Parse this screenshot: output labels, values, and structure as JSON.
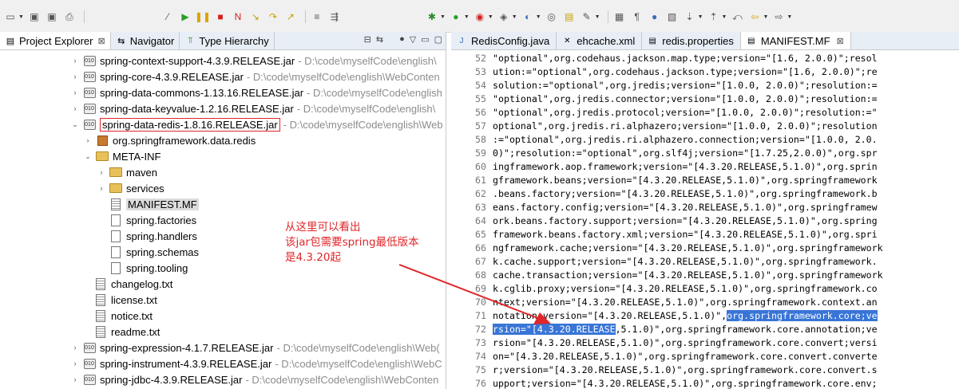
{
  "left_tabs": [
    {
      "label": "Project Explorer",
      "close": "⊠"
    },
    {
      "label": "Navigator",
      "close": ""
    },
    {
      "label": "Type Hierarchy",
      "close": ""
    }
  ],
  "tree": [
    {
      "name": "spring-context-support-4.3.9.RELEASE.jar",
      "path": "- D:\\code\\myselfCode\\english\\"
    },
    {
      "name": "spring-core-4.3.9.RELEASE.jar",
      "path": "- D:\\code\\myselfCode\\english\\WebConten"
    },
    {
      "name": "spring-data-commons-1.13.16.RELEASE.jar",
      "path": "- D:\\code\\myselfCode\\english"
    },
    {
      "name": "spring-data-keyvalue-1.2.16.RELEASE.jar",
      "path": "- D:\\code\\myselfCode\\english\\"
    },
    {
      "name": "spring-data-redis-1.8.16.RELEASE.jar",
      "path": "- D:\\code\\myselfCode\\english\\Web"
    },
    {
      "name": "org.springframework.data.redis",
      "path": ""
    },
    {
      "name": "META-INF",
      "path": ""
    },
    {
      "name": "maven",
      "path": ""
    },
    {
      "name": "services",
      "path": ""
    },
    {
      "name": "MANIFEST.MF",
      "path": ""
    },
    {
      "name": "spring.factories",
      "path": ""
    },
    {
      "name": "spring.handlers",
      "path": ""
    },
    {
      "name": "spring.schemas",
      "path": ""
    },
    {
      "name": "spring.tooling",
      "path": ""
    },
    {
      "name": "changelog.txt",
      "path": ""
    },
    {
      "name": "license.txt",
      "path": ""
    },
    {
      "name": "notice.txt",
      "path": ""
    },
    {
      "name": "readme.txt",
      "path": ""
    },
    {
      "name": "spring-expression-4.1.7.RELEASE.jar",
      "path": "- D:\\code\\myselfCode\\english\\Web("
    },
    {
      "name": "spring-instrument-4.3.9.RELEASE.jar",
      "path": "- D:\\code\\myselfCode\\english\\WebC"
    },
    {
      "name": "spring-jdbc-4.3.9.RELEASE.jar",
      "path": "- D:\\code\\myselfCode\\english\\WebConten"
    }
  ],
  "editor_tabs": [
    {
      "label": "RedisConfig.java",
      "close": ""
    },
    {
      "label": "ehcache.xml",
      "close": ""
    },
    {
      "label": "redis.properties",
      "close": ""
    },
    {
      "label": "MANIFEST.MF",
      "close": "⊠"
    }
  ],
  "code_lines": [
    {
      "n": "52",
      "t": "\"optional\",org.codehaus.jackson.map.type;version=\"[1.6, 2.0.0)\";resol",
      "hl": ""
    },
    {
      "n": "53",
      "t": "ution:=\"optional\",org.codehaus.jackson.type;version=\"[1.6, 2.0.0)\";re",
      "hl": ""
    },
    {
      "n": "54",
      "t": "solution:=\"optional\",org.jredis;version=\"[1.0.0, 2.0.0)\";resolution:=",
      "hl": ""
    },
    {
      "n": "55",
      "t": "\"optional\",org.jredis.connector;version=\"[1.0.0, 2.0.0)\";resolution:=",
      "hl": ""
    },
    {
      "n": "56",
      "t": "\"optional\",org.jredis.protocol;version=\"[1.0.0, 2.0.0)\";resolution:=\"",
      "hl": ""
    },
    {
      "n": "57",
      "t": "optional\",org.jredis.ri.alphazero;version=\"[1.0.0, 2.0.0)\";resolution",
      "hl": ""
    },
    {
      "n": "58",
      "t": ":=\"optional\",org.jredis.ri.alphazero.connection;version=\"[1.0.0, 2.0.",
      "hl": ""
    },
    {
      "n": "59",
      "t": "0)\";resolution:=\"optional\",org.slf4j;version=\"[1.7.25,2.0.0)\",org.spr",
      "hl": ""
    },
    {
      "n": "60",
      "t": "ingframework.aop.framework;version=\"[4.3.20.RELEASE,5.1.0)\",org.sprin",
      "hl": ""
    },
    {
      "n": "61",
      "t": "gframework.beans;version=\"[4.3.20.RELEASE,5.1.0)\",org.springframework",
      "hl": ""
    },
    {
      "n": "62",
      "t": ".beans.factory;version=\"[4.3.20.RELEASE,5.1.0)\",org.springframework.b",
      "hl": ""
    },
    {
      "n": "63",
      "t": "eans.factory.config;version=\"[4.3.20.RELEASE,5.1.0)\",org.springframew",
      "hl": ""
    },
    {
      "n": "64",
      "t": "ork.beans.factory.support;version=\"[4.3.20.RELEASE,5.1.0)\",org.spring",
      "hl": ""
    },
    {
      "n": "65",
      "t": "framework.beans.factory.xml;version=\"[4.3.20.RELEASE,5.1.0)\",org.spri",
      "hl": ""
    },
    {
      "n": "66",
      "t": "ngframework.cache;version=\"[4.3.20.RELEASE,5.1.0)\",org.springframework",
      "hl": ""
    },
    {
      "n": "67",
      "t": "k.cache.support;version=\"[4.3.20.RELEASE,5.1.0)\",org.springframework.",
      "hl": ""
    },
    {
      "n": "68",
      "t": "cache.transaction;version=\"[4.3.20.RELEASE,5.1.0)\",org.springframework",
      "hl": ""
    },
    {
      "n": "69",
      "t": "k.cglib.proxy;version=\"[4.3.20.RELEASE,5.1.0)\",org.springframework.co",
      "hl": ""
    },
    {
      "n": "70",
      "t": "ntext;version=\"[4.3.20.RELEASE,5.1.0)\",org.springframework.context.an",
      "hl": ""
    },
    {
      "n": "71",
      "t": "notation;version=\"[4.3.20.RELEASE,5.1.0)\",",
      "hl": "org.springframework.core;ve"
    },
    {
      "n": "72",
      "t": "",
      "hl": "rsion=\"[4.3.20.RELEASE",
      "tail": ",5.1.0)\",org.springframework.core.annotation;ve"
    },
    {
      "n": "73",
      "t": "rsion=\"[4.3.20.RELEASE,5.1.0)\",org.springframework.core.convert;versi",
      "hl": ""
    },
    {
      "n": "74",
      "t": "on=\"[4.3.20.RELEASE,5.1.0)\",org.springframework.core.convert.converte",
      "hl": ""
    },
    {
      "n": "75",
      "t": "r;version=\"[4.3.20.RELEASE,5.1.0)\",org.springframework.core.convert.s",
      "hl": ""
    },
    {
      "n": "76",
      "t": "upport;version=\"[4.3.20.RELEASE,5.1.0)\",org.springframework.core.env;",
      "hl": ""
    }
  ],
  "annotation": {
    "line1": "从这里可以看出",
    "line2": "该jar包需要spring最低版本",
    "line3": "是4.3.20起",
    "color": "#e0262a"
  },
  "colors": {
    "selection": "#3875d7",
    "highlight_box": "#e0262a"
  }
}
